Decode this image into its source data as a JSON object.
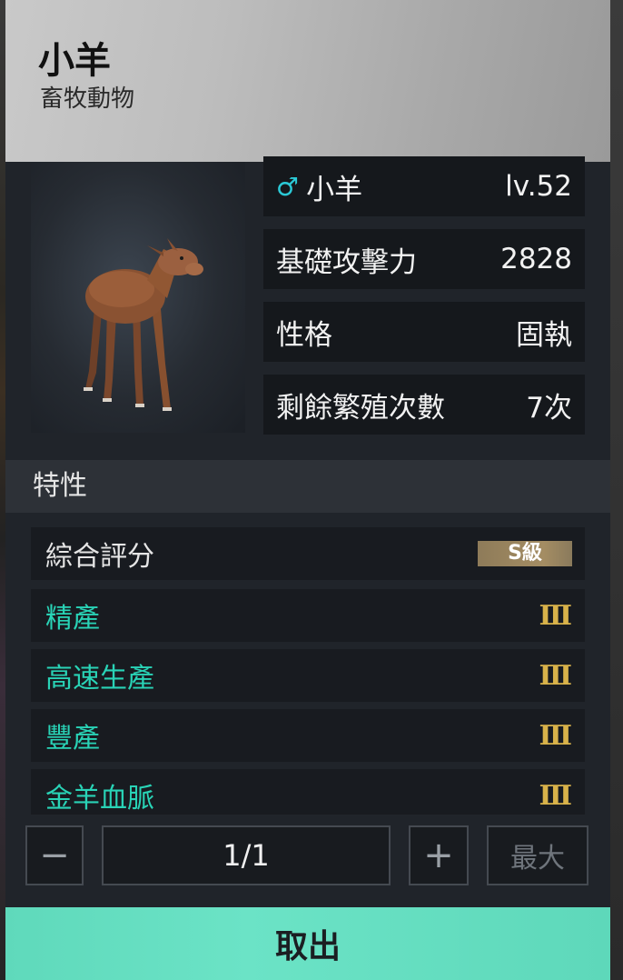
{
  "header": {
    "title": "小羊",
    "subtitle": "畜牧動物"
  },
  "portrait": {
    "alt": "brown lamb model"
  },
  "stats": {
    "name_row": {
      "gender_icon": "male-icon",
      "gender_glyph": "♂",
      "name": "小羊",
      "level": "lv.52"
    },
    "attack": {
      "label": "基礎攻擊力",
      "value": "2828"
    },
    "personality": {
      "label": "性格",
      "value": "固執"
    },
    "breeding": {
      "label": "剩餘繁殖次數",
      "value": "7次"
    }
  },
  "traits": {
    "heading": "特性",
    "overall": {
      "label": "綜合評分",
      "grade": "S級"
    },
    "items": [
      {
        "name": "精產",
        "rank": "Ⅲ"
      },
      {
        "name": "高速生產",
        "rank": "Ⅲ"
      },
      {
        "name": "豐產",
        "rank": "Ⅲ"
      },
      {
        "name": "金羊血脈",
        "rank": "Ⅲ"
      }
    ]
  },
  "quantity": {
    "minus": "−",
    "value": "1/1",
    "plus": "+",
    "max_label": "最大"
  },
  "action": {
    "take_label": "取出"
  },
  "colors": {
    "accent_teal": "#29d3b6",
    "rank_gold": "#d8b24a",
    "button_mint": "#6be3c6",
    "gender_cyan": "#2bc9d6"
  }
}
